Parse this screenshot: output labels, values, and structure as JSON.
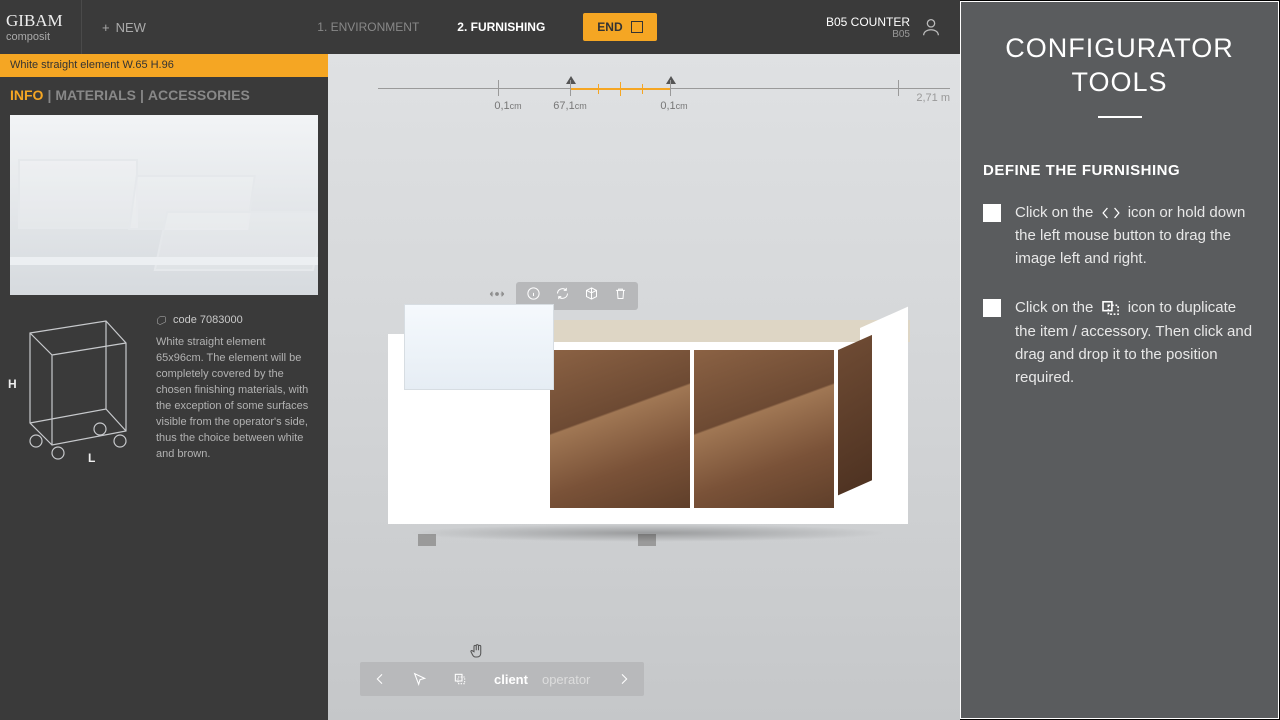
{
  "brand": {
    "line1": "GIBAM",
    "line2": "composit"
  },
  "new_button": "NEW",
  "steps": {
    "s1": "1. ENVIRONMENT",
    "s2": "2. FURNISHING"
  },
  "end_button": "END",
  "user": {
    "name": "B05 COUNTER",
    "sub": "B05"
  },
  "strip": "White straight element W.65 H.96",
  "tabs": {
    "info": "INFO",
    "materials": "MATERIALS",
    "accessories": "ACCESSORIES"
  },
  "dims": {
    "H": "H",
    "L": "L"
  },
  "spec": {
    "code": "code 7083000",
    "desc": "White straight element 65x96cm. The element will be completely covered by the chosen finishing materials, with the exception of some surfaces visible from the operator's side, thus the choice between white and brown."
  },
  "ruler": {
    "a": "0,1",
    "a_unit": "cm",
    "b": "67,1",
    "b_unit": "cm",
    "c": "0,1",
    "c_unit": "cm",
    "total": "2,71 m"
  },
  "views": {
    "client": "client",
    "operator": "operator"
  },
  "help": {
    "title1": "CONFIGURATOR",
    "title2": "TOOLS",
    "heading": "DEFINE THE FURNISHING",
    "tip1a": "Click on the",
    "tip1b": "icon or hold down the left mouse button to drag the image left and right.",
    "tip2a": "Click on the",
    "tip2b": "icon to duplicate the item / accessory. Then click and drag and drop it to the position required."
  }
}
